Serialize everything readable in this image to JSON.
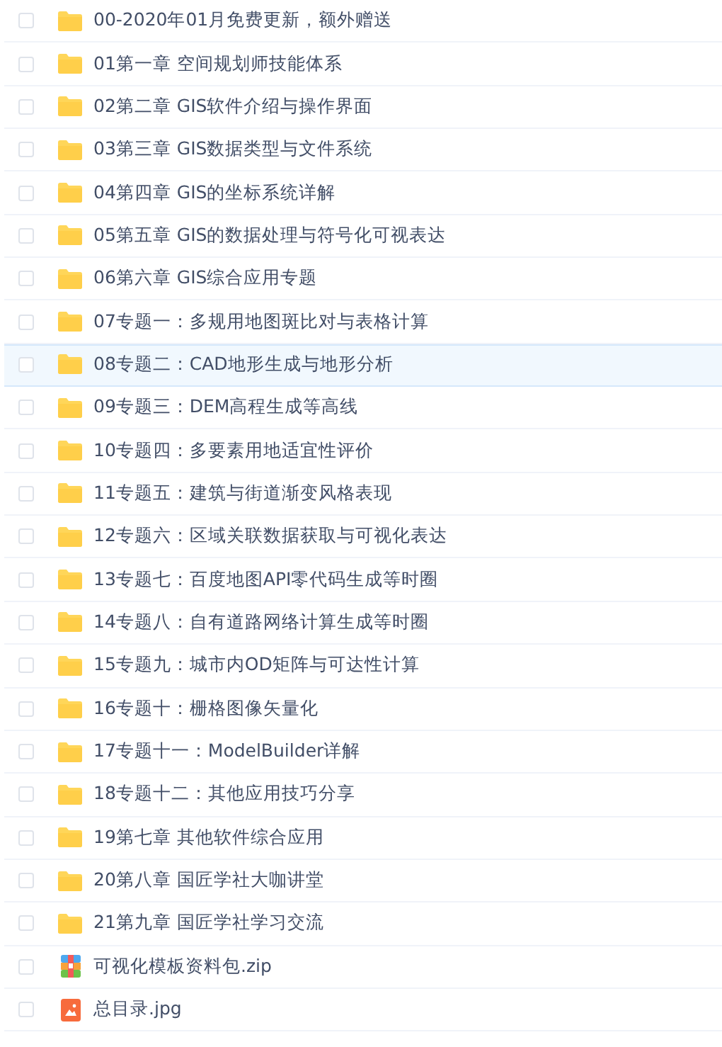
{
  "files": [
    {
      "name": "00-2020年01月免费更新，额外赠送",
      "kind": "folder",
      "selected": false
    },
    {
      "name": "01第一章 空间规划师技能体系",
      "kind": "folder",
      "selected": false
    },
    {
      "name": "02第二章 GIS软件介绍与操作界面",
      "kind": "folder",
      "selected": false
    },
    {
      "name": "03第三章 GIS数据类型与文件系统",
      "kind": "folder",
      "selected": false
    },
    {
      "name": "04第四章 GIS的坐标系统详解",
      "kind": "folder",
      "selected": false
    },
    {
      "name": "05第五章 GIS的数据处理与符号化可视表达",
      "kind": "folder",
      "selected": false
    },
    {
      "name": "06第六章 GIS综合应用专题",
      "kind": "folder",
      "selected": false
    },
    {
      "name": "07专题一：多规用地图斑比对与表格计算",
      "kind": "folder",
      "selected": false
    },
    {
      "name": "08专题二：CAD地形生成与地形分析",
      "kind": "folder",
      "selected": true
    },
    {
      "name": "09专题三：DEM高程生成等高线",
      "kind": "folder",
      "selected": false
    },
    {
      "name": "10专题四：多要素用地适宜性评价",
      "kind": "folder",
      "selected": false
    },
    {
      "name": "11专题五：建筑与街道渐变风格表现",
      "kind": "folder",
      "selected": false
    },
    {
      "name": "12专题六：区域关联数据获取与可视化表达",
      "kind": "folder",
      "selected": false
    },
    {
      "name": "13专题七：百度地图API零代码生成等时圈",
      "kind": "folder",
      "selected": false
    },
    {
      "name": "14专题八：自有道路网络计算生成等时圈",
      "kind": "folder",
      "selected": false
    },
    {
      "name": "15专题九：城市内OD矩阵与可达性计算",
      "kind": "folder",
      "selected": false
    },
    {
      "name": "16专题十：栅格图像矢量化",
      "kind": "folder",
      "selected": false
    },
    {
      "name": "17专题十一：ModelBuilder详解",
      "kind": "folder",
      "selected": false
    },
    {
      "name": "18专题十二：其他应用技巧分享",
      "kind": "folder",
      "selected": false
    },
    {
      "name": "19第七章 其他软件综合应用",
      "kind": "folder",
      "selected": false
    },
    {
      "name": "20第八章 国匠学社大咖讲堂",
      "kind": "folder",
      "selected": false
    },
    {
      "name": "21第九章 国匠学社学习交流",
      "kind": "folder",
      "selected": false
    },
    {
      "name": "可视化模板资料包.zip",
      "kind": "zip",
      "selected": false
    },
    {
      "name": "总目录.jpg",
      "kind": "image",
      "selected": false
    }
  ]
}
